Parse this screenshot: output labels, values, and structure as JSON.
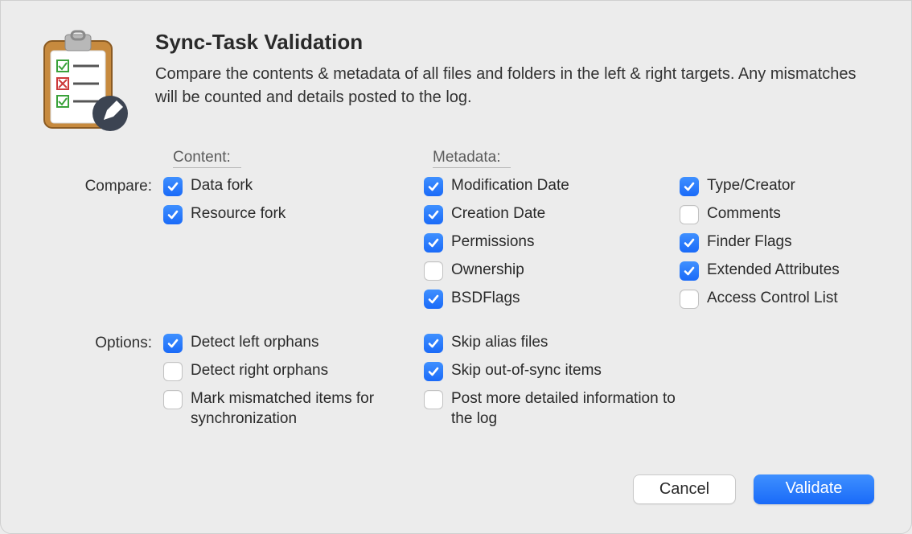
{
  "header": {
    "title": "Sync-Task Validation",
    "description": "Compare the contents & metadata of all files and folders in the left & right targets. Any mismatches will be counted and details posted to the log."
  },
  "sections": {
    "content_header": "Content:",
    "metadata_header": "Metadata:"
  },
  "labels": {
    "compare": "Compare:",
    "options": "Options:"
  },
  "compare": {
    "content": [
      {
        "label": "Data fork",
        "checked": true
      },
      {
        "label": "Resource fork",
        "checked": true
      }
    ],
    "metadata_col1": [
      {
        "label": "Modification Date",
        "checked": true
      },
      {
        "label": "Creation Date",
        "checked": true
      },
      {
        "label": "Permissions",
        "checked": true
      },
      {
        "label": "Ownership",
        "checked": false
      },
      {
        "label": "BSDFlags",
        "checked": true
      }
    ],
    "metadata_col2": [
      {
        "label": "Type/Creator",
        "checked": true
      },
      {
        "label": "Comments",
        "checked": false
      },
      {
        "label": "Finder Flags",
        "checked": true
      },
      {
        "label": "Extended Attributes",
        "checked": true
      },
      {
        "label": "Access Control List",
        "checked": false
      }
    ]
  },
  "options": {
    "col1": [
      {
        "label": "Detect left orphans",
        "checked": true
      },
      {
        "label": "Detect right orphans",
        "checked": false
      },
      {
        "label": "Mark mismatched items for synchronization",
        "checked": false
      }
    ],
    "col2": [
      {
        "label": "Skip alias files",
        "checked": true
      },
      {
        "label": "Skip out-of-sync items",
        "checked": true
      },
      {
        "label": "Post more detailed information to the log",
        "checked": false
      }
    ]
  },
  "buttons": {
    "cancel": "Cancel",
    "validate": "Validate"
  }
}
